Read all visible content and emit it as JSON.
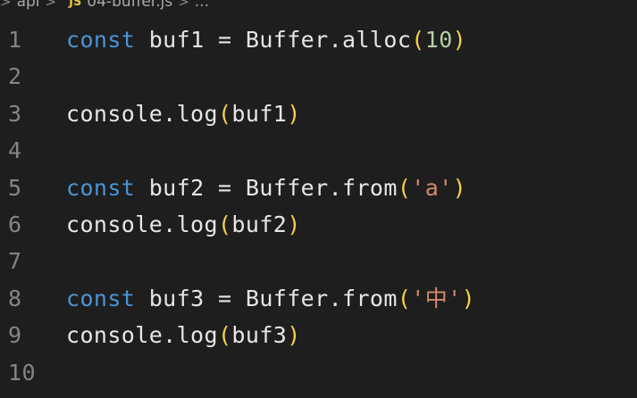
{
  "breadcrumb": {
    "folder": "api",
    "file_badge": "JS",
    "file": "04-buffer.js",
    "more": "...",
    "separator": ">"
  },
  "code_lines": [
    {
      "number": "1",
      "tokens": [
        "const",
        " buf1 = Buffer.alloc",
        "(",
        "10",
        ")"
      ]
    },
    {
      "number": "2",
      "tokens": []
    },
    {
      "number": "3",
      "tokens": [
        "console.log",
        "(",
        "buf1",
        ")"
      ]
    },
    {
      "number": "4",
      "tokens": []
    },
    {
      "number": "5",
      "tokens": [
        "const",
        " buf2 = Buffer.from",
        "(",
        "'a'",
        ")"
      ]
    },
    {
      "number": "6",
      "tokens": [
        "console.log",
        "(",
        "buf2",
        ")"
      ]
    },
    {
      "number": "7",
      "tokens": []
    },
    {
      "number": "8",
      "tokens": [
        "const",
        " buf3 = Buffer.from",
        "(",
        "'中'",
        ")"
      ]
    },
    {
      "number": "9",
      "tokens": [
        "console.log",
        "(",
        "buf3",
        ")"
      ]
    },
    {
      "number": "10",
      "tokens": []
    }
  ],
  "colors": {
    "background": "#1e1e1e",
    "keyword": "#4a94d6",
    "identifier": "#e6e6e6",
    "bracket": "#f7d04a",
    "number": "#b5cea8",
    "string": "#d38a6a",
    "line_number": "#858585"
  }
}
